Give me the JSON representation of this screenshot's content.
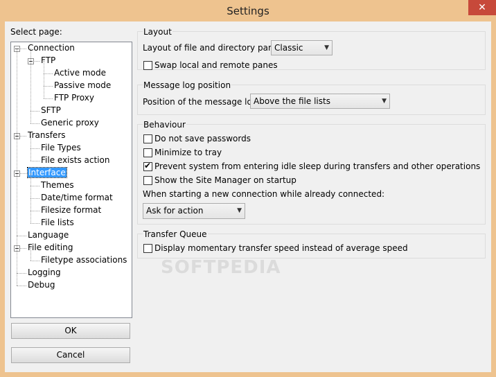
{
  "window": {
    "title": "Settings",
    "close_symbol": "✕"
  },
  "left": {
    "select_page_label": "Select page:",
    "tree": [
      {
        "label": "Connection",
        "level": 0
      },
      {
        "label": "FTP",
        "level": 1
      },
      {
        "label": "Active mode",
        "level": 2
      },
      {
        "label": "Passive mode",
        "level": 2
      },
      {
        "label": "FTP Proxy",
        "level": 2
      },
      {
        "label": "SFTP",
        "level": 1
      },
      {
        "label": "Generic proxy",
        "level": 1
      },
      {
        "label": "Transfers",
        "level": 0
      },
      {
        "label": "File Types",
        "level": 1
      },
      {
        "label": "File exists action",
        "level": 1
      },
      {
        "label": "Interface",
        "level": 0,
        "selected": true
      },
      {
        "label": "Themes",
        "level": 1
      },
      {
        "label": "Date/time format",
        "level": 1
      },
      {
        "label": "Filesize format",
        "level": 1
      },
      {
        "label": "File lists",
        "level": 1
      },
      {
        "label": "Language",
        "level": 0
      },
      {
        "label": "File editing",
        "level": 0
      },
      {
        "label": "Filetype associations",
        "level": 1
      },
      {
        "label": "Logging",
        "level": 0
      },
      {
        "label": "Debug",
        "level": 0
      }
    ],
    "ok_label": "OK",
    "cancel_label": "Cancel"
  },
  "layout": {
    "title": "Layout",
    "panes_label": "Layout of file and directory panes:",
    "panes_value": "Classic",
    "swap_label": "Swap local and remote panes",
    "swap_checked": false
  },
  "message_log": {
    "title": "Message log position",
    "position_label": "Position of the message log:",
    "position_value": "Above the file lists"
  },
  "behaviour": {
    "title": "Behaviour",
    "options": [
      {
        "label": "Do not save passwords",
        "checked": false
      },
      {
        "label": "Minimize to tray",
        "checked": false
      },
      {
        "label": "Prevent system from entering idle sleep during transfers and other operations",
        "checked": true
      },
      {
        "label": "Show the Site Manager on startup",
        "checked": false
      }
    ],
    "new_conn_label": "When starting a new connection while already connected:",
    "new_conn_value": "Ask for action"
  },
  "transfer_queue": {
    "title": "Transfer Queue",
    "speed_label": "Display momentary transfer speed instead of average speed",
    "speed_checked": false
  },
  "watermark": "SOFTPEDIA",
  "checkmark_glyph": "✔",
  "dropdown_arrow_glyph": "▼"
}
